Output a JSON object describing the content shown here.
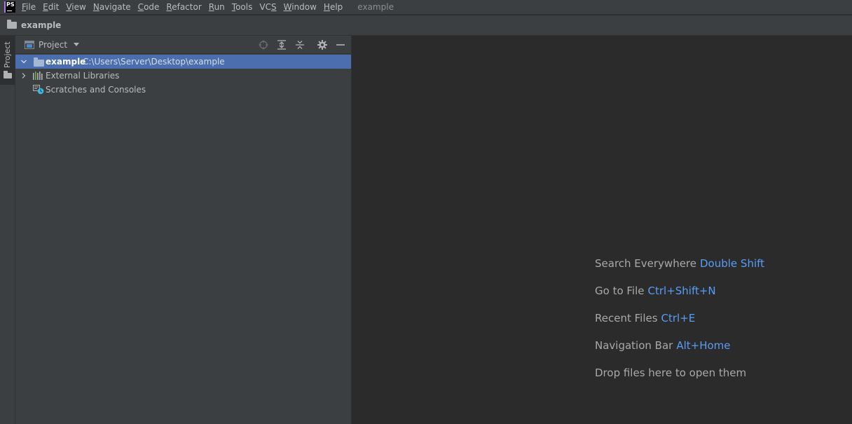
{
  "menubar": {
    "logo": "PS",
    "items": [
      {
        "mn": "F",
        "rest": "ile"
      },
      {
        "mn": "E",
        "rest": "dit"
      },
      {
        "mn": "V",
        "rest": "iew"
      },
      {
        "mn": "N",
        "rest": "avigate"
      },
      {
        "mn": "C",
        "rest": "ode"
      },
      {
        "mn": "R",
        "rest": "efactor"
      },
      {
        "mn": "R",
        "rest": "un"
      },
      {
        "mn": "T",
        "rest": "ools"
      },
      {
        "pre": "VC",
        "mn": "S",
        "rest": ""
      },
      {
        "mn": "W",
        "rest": "indow"
      },
      {
        "mn": "H",
        "rest": "elp"
      }
    ],
    "window_title": "example"
  },
  "navbar": {
    "crumb": "example",
    "icon": "folder-icon"
  },
  "toolstrip": {
    "project_label": "Project"
  },
  "project_panel": {
    "title": "Project",
    "actions": [
      "locate-icon",
      "expand-all-icon",
      "collapse-all-icon",
      "gear-icon",
      "minimize-icon"
    ],
    "tree": {
      "root": {
        "name": "example",
        "path": "C:\\Users\\Server\\Desktop\\example",
        "expanded": true
      },
      "external_libraries": "External Libraries",
      "scratches": "Scratches and Consoles"
    }
  },
  "editor": {
    "hints": [
      {
        "label": "Search Everywhere",
        "key": "Double Shift"
      },
      {
        "label": "Go to File",
        "key": "Ctrl+Shift+N"
      },
      {
        "label": "Recent Files",
        "key": "Ctrl+E"
      },
      {
        "label": "Navigation Bar",
        "key": "Alt+Home"
      },
      {
        "label": "Drop files here to open them",
        "key": ""
      }
    ]
  },
  "colors": {
    "background": "#2b2b2b",
    "panel": "#3c3f41",
    "selection": "#4b6eaf",
    "shortcut": "#589df6"
  }
}
